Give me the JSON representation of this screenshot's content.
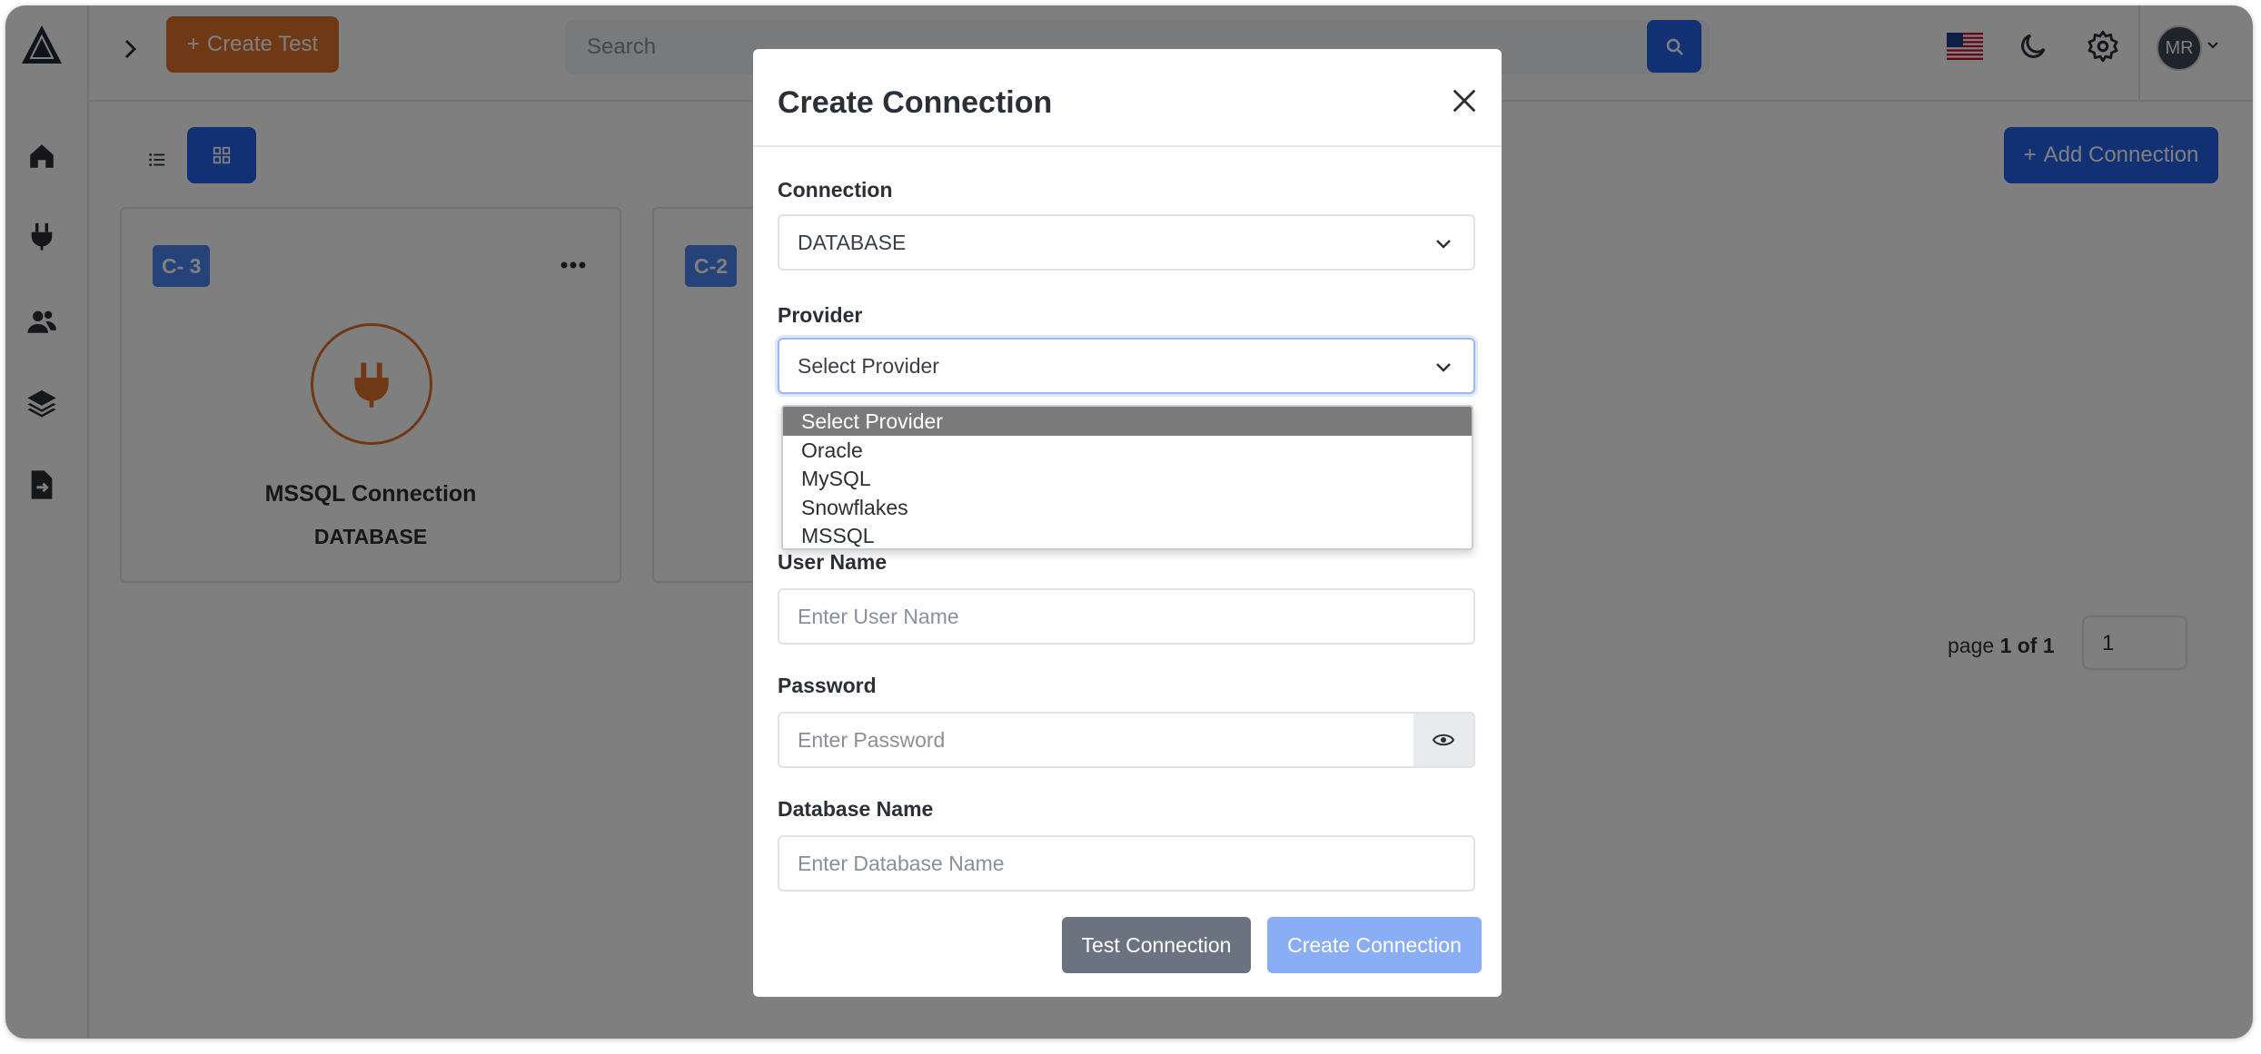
{
  "topbar": {
    "create_test_label": "Create Test",
    "search_placeholder": "Search",
    "avatar_initials": "MR"
  },
  "toolbar": {
    "add_connection_label": "Add Connection"
  },
  "cards": [
    {
      "badge": "C- 3",
      "name": "MSSQL Connection",
      "type": "DATABASE"
    },
    {
      "badge": "C-2"
    }
  ],
  "pagination": {
    "prefix": "page",
    "current_of_total": "1 of 1",
    "page_input": "1"
  },
  "modal": {
    "title": "Create Connection",
    "connection_label": "Connection",
    "connection_value": "DATABASE",
    "provider_label": "Provider",
    "provider_value": "Select Provider",
    "provider_options": [
      "Select Provider",
      "Oracle",
      "MySQL",
      "Snowflakes",
      "MSSQL"
    ],
    "username_label": "User Name",
    "username_placeholder": "Enter User Name",
    "password_label": "Password",
    "password_placeholder": "Enter Password",
    "dbname_label": "Database Name",
    "dbname_placeholder": "Enter Database Name",
    "test_button": "Test Connection",
    "create_button": "Create Connection"
  },
  "colors": {
    "primary": "#2563eb",
    "accent_orange": "#e0732d",
    "badge_blue": "#4a86f2"
  }
}
